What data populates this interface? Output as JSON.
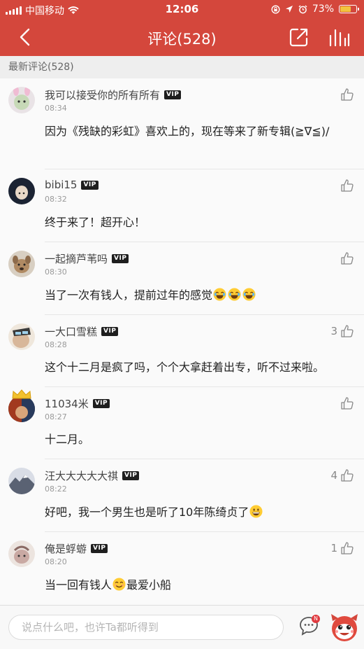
{
  "status_bar": {
    "carrier": "中国移动",
    "time": "12:06",
    "battery_percent": "73%",
    "battery_level": 0.73,
    "icons": [
      "signal-icon",
      "wifi-icon",
      "rotation-lock-icon",
      "location-icon",
      "alarm-icon",
      "battery-icon"
    ]
  },
  "nav": {
    "title": "评论(528)",
    "icons": [
      "back-arrow-icon",
      "share-icon",
      "chart-icon"
    ]
  },
  "section": {
    "header": "最新评论(528)"
  },
  "colors": {
    "brand": "#d4473c",
    "vip_badge": "#1e1e1e"
  },
  "comments": [
    {
      "username": "我可以接受你的所有所有",
      "vip": "VIP",
      "time": "08:34",
      "likes": "",
      "text": "因为《残缺的彩虹》喜欢上的，现在等来了新专辑(≧∇≦)/",
      "emojis": []
    },
    {
      "username": "bibi15",
      "vip": "VIP",
      "time": "08:32",
      "likes": "",
      "text": "终于来了！超开心！",
      "emojis": []
    },
    {
      "username": "一起摘芦苇吗",
      "vip": "VIP",
      "time": "08:30",
      "likes": "",
      "text": "当了一次有钱人，提前过年的感觉",
      "emojis": [
        "joy-emoji",
        "joy-emoji",
        "joy-emoji"
      ]
    },
    {
      "username": "一大口雪糕",
      "vip": "VIP",
      "time": "08:28",
      "likes": "3",
      "text": "这个十二月是疯了吗，个个大拿赶着出专，听不过来啦。",
      "emojis": []
    },
    {
      "username": "11034米",
      "vip": "VIP",
      "time": "08:27",
      "likes": "",
      "text": "十二月。",
      "emojis": []
    },
    {
      "username": "汪大大大大大祺",
      "vip": "VIP",
      "time": "08:22",
      "likes": "4",
      "text": "好吧，我一个男生也是听了10年陈绮贞了",
      "emojis": [
        "grin-emoji"
      ]
    },
    {
      "username": "俺是蜉蝣",
      "vip": "VIP",
      "time": "08:20",
      "likes": "1",
      "text": "当一回有钱人",
      "text_after": "最爱小船",
      "emojis": [
        "smile-emoji"
      ]
    }
  ],
  "bottom_bar": {
    "placeholder": "说点什么吧，也许Ta都听得到",
    "badge": "N"
  }
}
